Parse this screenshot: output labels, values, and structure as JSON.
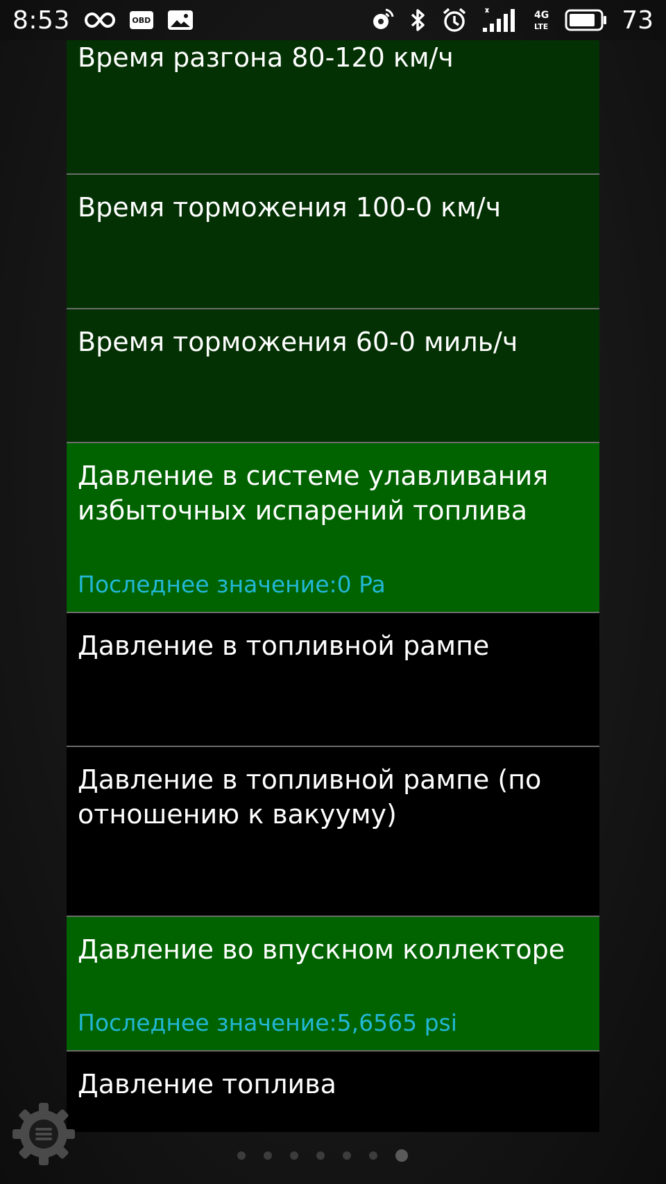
{
  "status_bar": {
    "time": "8:53",
    "obd_badge": "OBD",
    "battery": "73",
    "icons": [
      "infinity-icon",
      "obd-icon",
      "image-icon",
      "hotspot-icon",
      "bluetooth-icon",
      "alarm-icon",
      "signal-icon",
      "lte-icon",
      "battery-icon"
    ]
  },
  "items": [
    {
      "title": "Время разгона 80-120 км/ч",
      "value": "",
      "style": "dark"
    },
    {
      "title": "Время торможения 100-0 км/ч",
      "value": "",
      "style": "dark"
    },
    {
      "title": "Время торможения 60-0 миль/ч",
      "value": "",
      "style": "dark"
    },
    {
      "title": "Давление в системе улавливания избыточных испарений топлива",
      "value": "Последнее значение:0 Pa",
      "style": "green"
    },
    {
      "title": "Давление в топливной рампе",
      "value": "",
      "style": "black"
    },
    {
      "title": "Давление в топливной рампе (по отношению к вакууму)",
      "value": "",
      "style": "black"
    },
    {
      "title": "Давление во впускном коллекторе",
      "value": "Последнее значение:5,6565 psi",
      "style": "green"
    },
    {
      "title": "Давление топлива",
      "value": "",
      "style": "black"
    }
  ],
  "pager": {
    "total": 7,
    "active": 7
  },
  "colors": {
    "dark_green": "#033103",
    "bright_green": "#006300",
    "value_cyan": "#23b7d6"
  }
}
